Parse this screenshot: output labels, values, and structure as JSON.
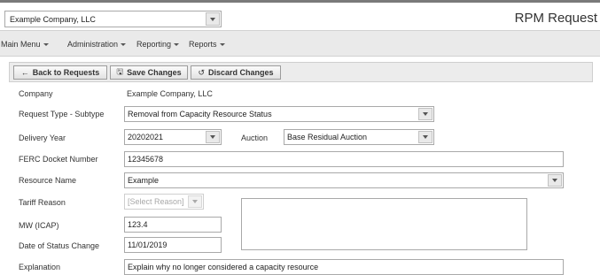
{
  "header": {
    "company_select": "Example Company, LLC",
    "app_title": "RPM Request"
  },
  "menu": [
    {
      "label": "Main Menu"
    },
    {
      "label": "Administration"
    },
    {
      "label": "Reporting"
    },
    {
      "label": "Reports"
    }
  ],
  "toolbar": {
    "back": {
      "icon": "←",
      "label": "Back to Requests"
    },
    "save": {
      "icon": "🖫",
      "label": "Save Changes"
    },
    "discard": {
      "icon": "↺",
      "label": "Discard Changes"
    }
  },
  "form": {
    "company": {
      "label": "Company",
      "value": "Example Company, LLC"
    },
    "request_type": {
      "label": "Request Type - Subtype",
      "value": "Removal from Capacity Resource Status"
    },
    "delivery_year": {
      "label": "Delivery Year",
      "value": "20202021"
    },
    "auction": {
      "label": "Auction",
      "value": "Base Residual Auction"
    },
    "ferc_docket": {
      "label": "FERC Docket Number",
      "value": "12345678"
    },
    "resource_name": {
      "label": "Resource Name",
      "value": "Example"
    },
    "tariff_reason": {
      "label": "Tariff Reason",
      "value": "[Select Reason]"
    },
    "mw_icap": {
      "label": "MW (ICAP)",
      "value": "123.4"
    },
    "status_change_date": {
      "label": "Date of Status Change",
      "value": "11/01/2019"
    },
    "explanation": {
      "label": "Explanation",
      "value": "Explain why no longer considered a capacity resource"
    }
  }
}
